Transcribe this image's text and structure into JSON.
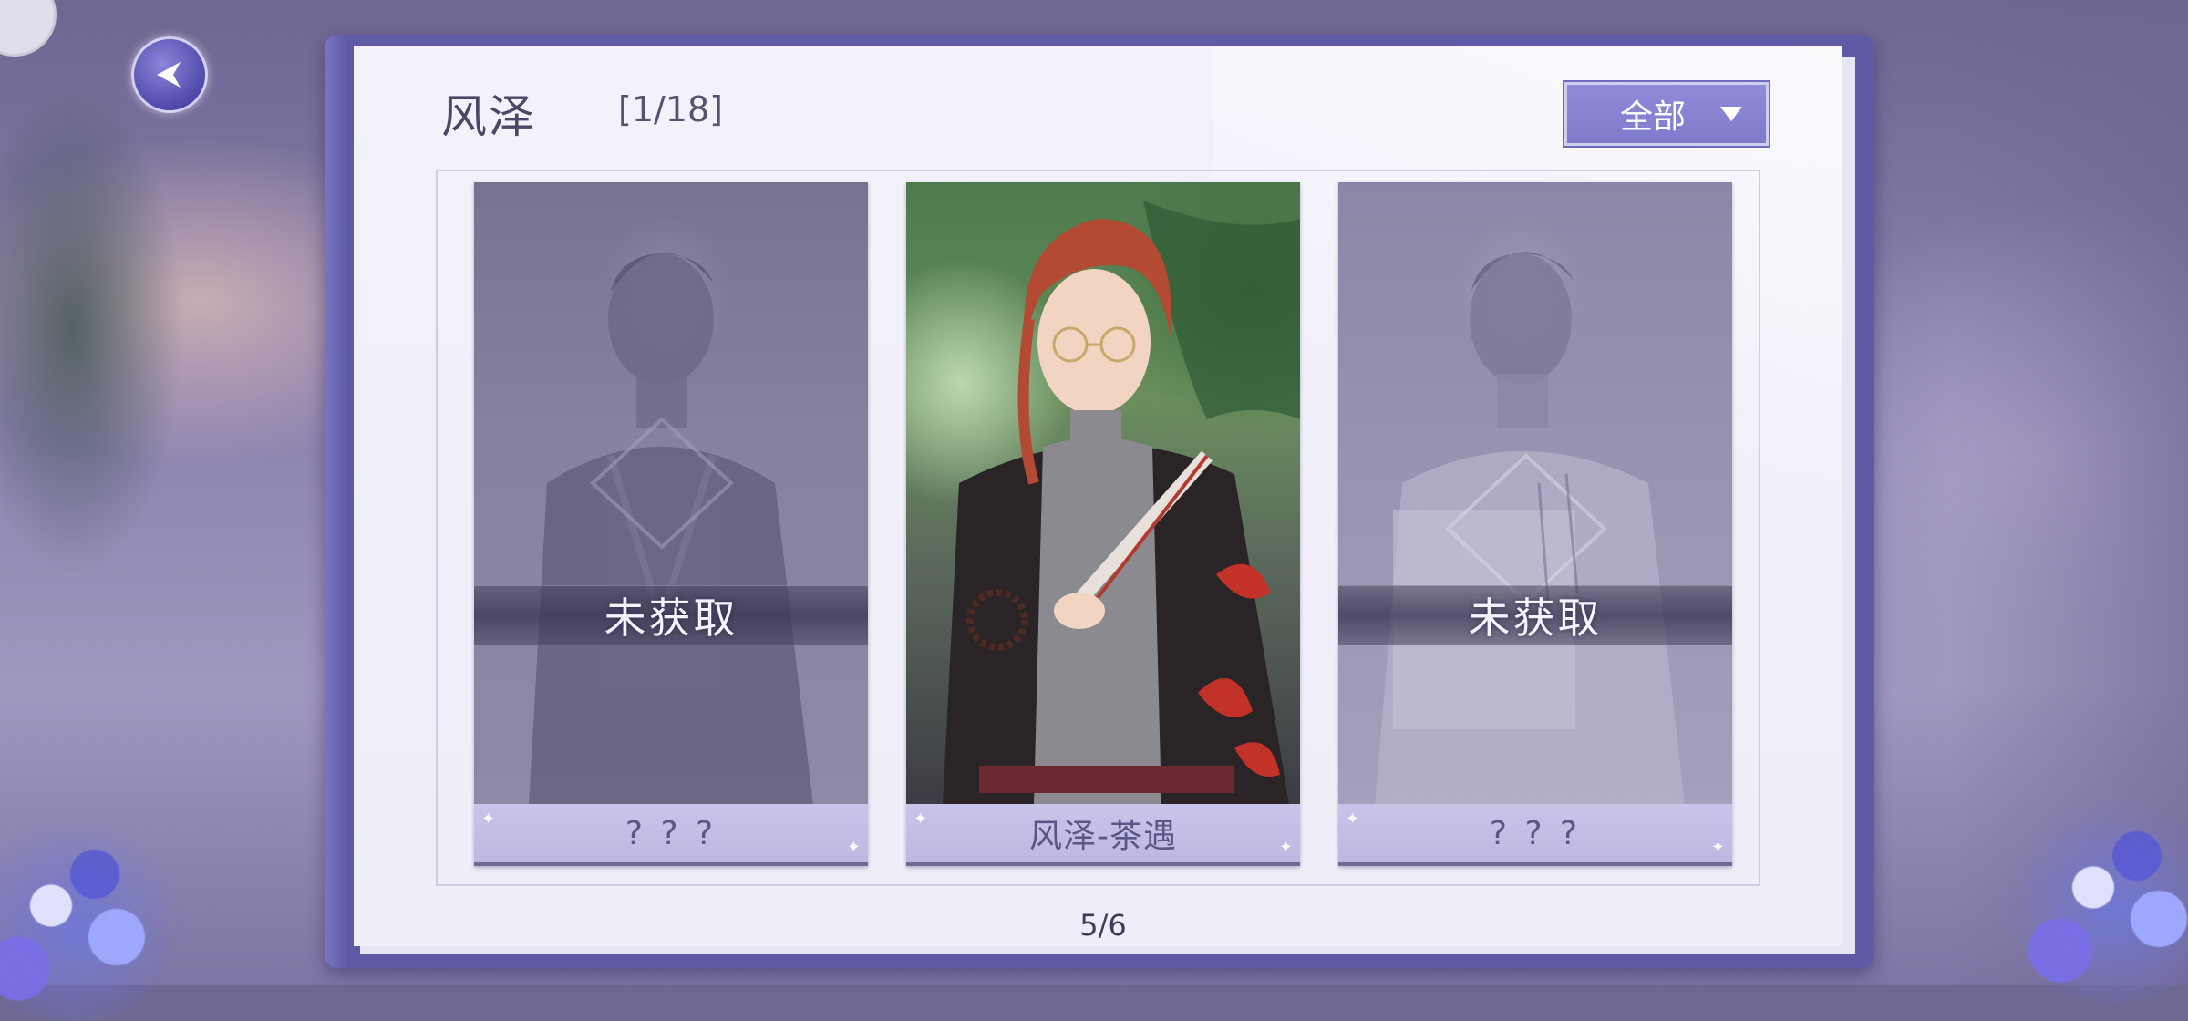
{
  "header": {
    "title": "风泽",
    "counter": "[1/18]"
  },
  "filter": {
    "label": "全部"
  },
  "cards": [
    {
      "status": "locked",
      "status_text": "未获取",
      "name": "? ? ?"
    },
    {
      "status": "unlocked",
      "status_text": "",
      "name": "风泽-茶遇"
    },
    {
      "status": "locked",
      "status_text": "未获取",
      "name": "? ? ?"
    }
  ],
  "pager": {
    "text": "5/6"
  },
  "colors": {
    "accent": "#7f7bcc",
    "book_cover": "#5e5aa6",
    "name_bar": "#c9c4ea"
  },
  "icons": {
    "back": "back-arrow-icon",
    "filter": "dropdown-caret-icon"
  }
}
